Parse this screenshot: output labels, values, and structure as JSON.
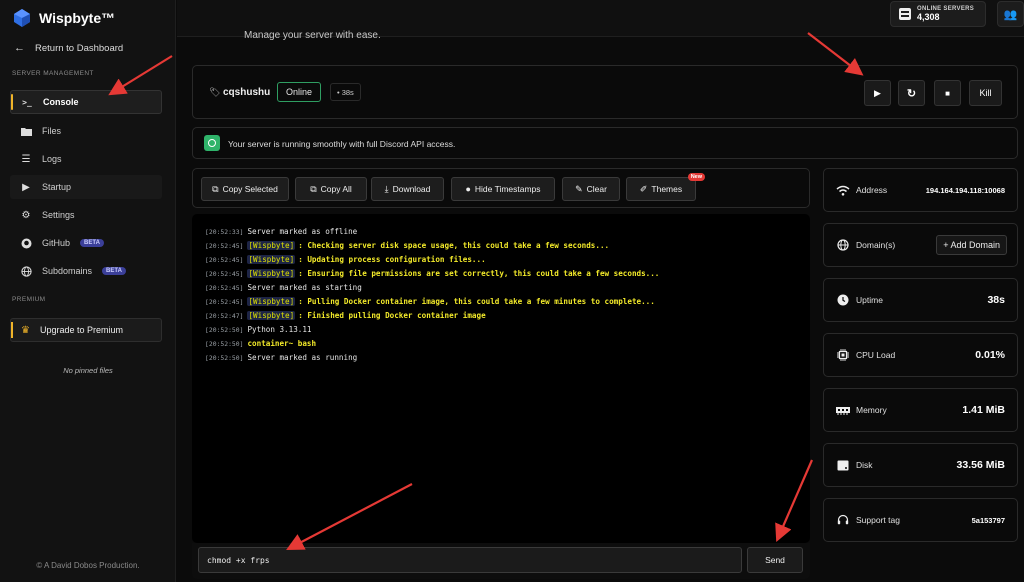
{
  "brand": {
    "name": "Wispbyte™"
  },
  "sidebar": {
    "back_label": "Return to Dashboard",
    "section_server": "SERVER MANAGEMENT",
    "items": [
      {
        "label": "Console",
        "icon": "terminal-icon"
      },
      {
        "label": "Files",
        "icon": "folder-icon"
      },
      {
        "label": "Logs",
        "icon": "list-icon"
      },
      {
        "label": "Startup",
        "icon": "play-icon"
      },
      {
        "label": "Settings",
        "icon": "gear-icon"
      },
      {
        "label": "GitHub",
        "icon": "github-icon",
        "badge": "BETA"
      },
      {
        "label": "Subdomains",
        "icon": "globe-icon",
        "badge": "BETA"
      }
    ],
    "section_premium": "PREMIUM",
    "premium_label": "Upgrade to Premium",
    "no_pinned": "No pinned files",
    "footer": "© A David Dobos Production."
  },
  "topbar": {
    "subtitle": "Manage your server with ease.",
    "online_label": "ONLINE SERVERS",
    "online_count": "4,308"
  },
  "server": {
    "name": "cqshushu",
    "status": "Online",
    "uptime_chip": "• 38s",
    "kill_label": "Kill"
  },
  "notice": {
    "text": "Your server is running smoothly with full Discord API access."
  },
  "toolbar": {
    "copy_selected": "Copy Selected",
    "copy_all": "Copy All",
    "download": "Download",
    "hide_timestamps": "Hide Timestamps",
    "clear": "Clear",
    "themes": "Themes",
    "new_badge": "New"
  },
  "console": {
    "lines": [
      {
        "ts": "[20:52:33]",
        "tag": "",
        "text": "Server marked as offline",
        "style": "plain"
      },
      {
        "ts": "[20:52:45]",
        "tag": "[Wispbyte]",
        "text": ": Checking server disk space usage, this could take a few seconds...",
        "style": "yellow"
      },
      {
        "ts": "[20:52:45]",
        "tag": "[Wispbyte]",
        "text": ": Updating process configuration files...",
        "style": "yellow"
      },
      {
        "ts": "[20:52:45]",
        "tag": "[Wispbyte]",
        "text": ": Ensuring file permissions are set correctly, this could take a few seconds...",
        "style": "yellow"
      },
      {
        "ts": "[20:52:45]",
        "tag": "",
        "text": "Server marked as starting",
        "style": "plain"
      },
      {
        "ts": "[20:52:45]",
        "tag": "[Wispbyte]",
        "text": ": Pulling Docker container image, this could take a few minutes to complete...",
        "style": "yellow"
      },
      {
        "ts": "[20:52:47]",
        "tag": "[Wispbyte]",
        "text": ": Finished pulling Docker container image",
        "style": "yellow"
      },
      {
        "ts": "[20:52:50]",
        "tag": "",
        "text": "Python 3.13.11",
        "style": "plain"
      },
      {
        "ts": "[20:52:50]",
        "tag": "",
        "text": "container~ bash",
        "style": "prompt"
      },
      {
        "ts": "[20:52:50]",
        "tag": "",
        "text": "Server marked as running",
        "style": "plain"
      }
    ],
    "command_value": "chmod +x frps",
    "send_label": "Send"
  },
  "stats": {
    "address_label": "Address",
    "address_value": "194.164.194.118:10068",
    "domains_label": "Domain(s)",
    "add_domain": "+ Add Domain",
    "uptime_label": "Uptime",
    "uptime_value": "38s",
    "cpu_label": "CPU Load",
    "cpu_value": "0.01%",
    "memory_label": "Memory",
    "memory_value": "1.41 MiB",
    "disk_label": "Disk",
    "disk_value": "33.56 MiB",
    "support_label": "Support tag",
    "support_value": "5a153797"
  },
  "colors": {
    "accent_gold": "#f0b429",
    "online_green": "#2f9e62",
    "log_yellow": "#f3ea2a",
    "annotation_red": "#e53935"
  }
}
